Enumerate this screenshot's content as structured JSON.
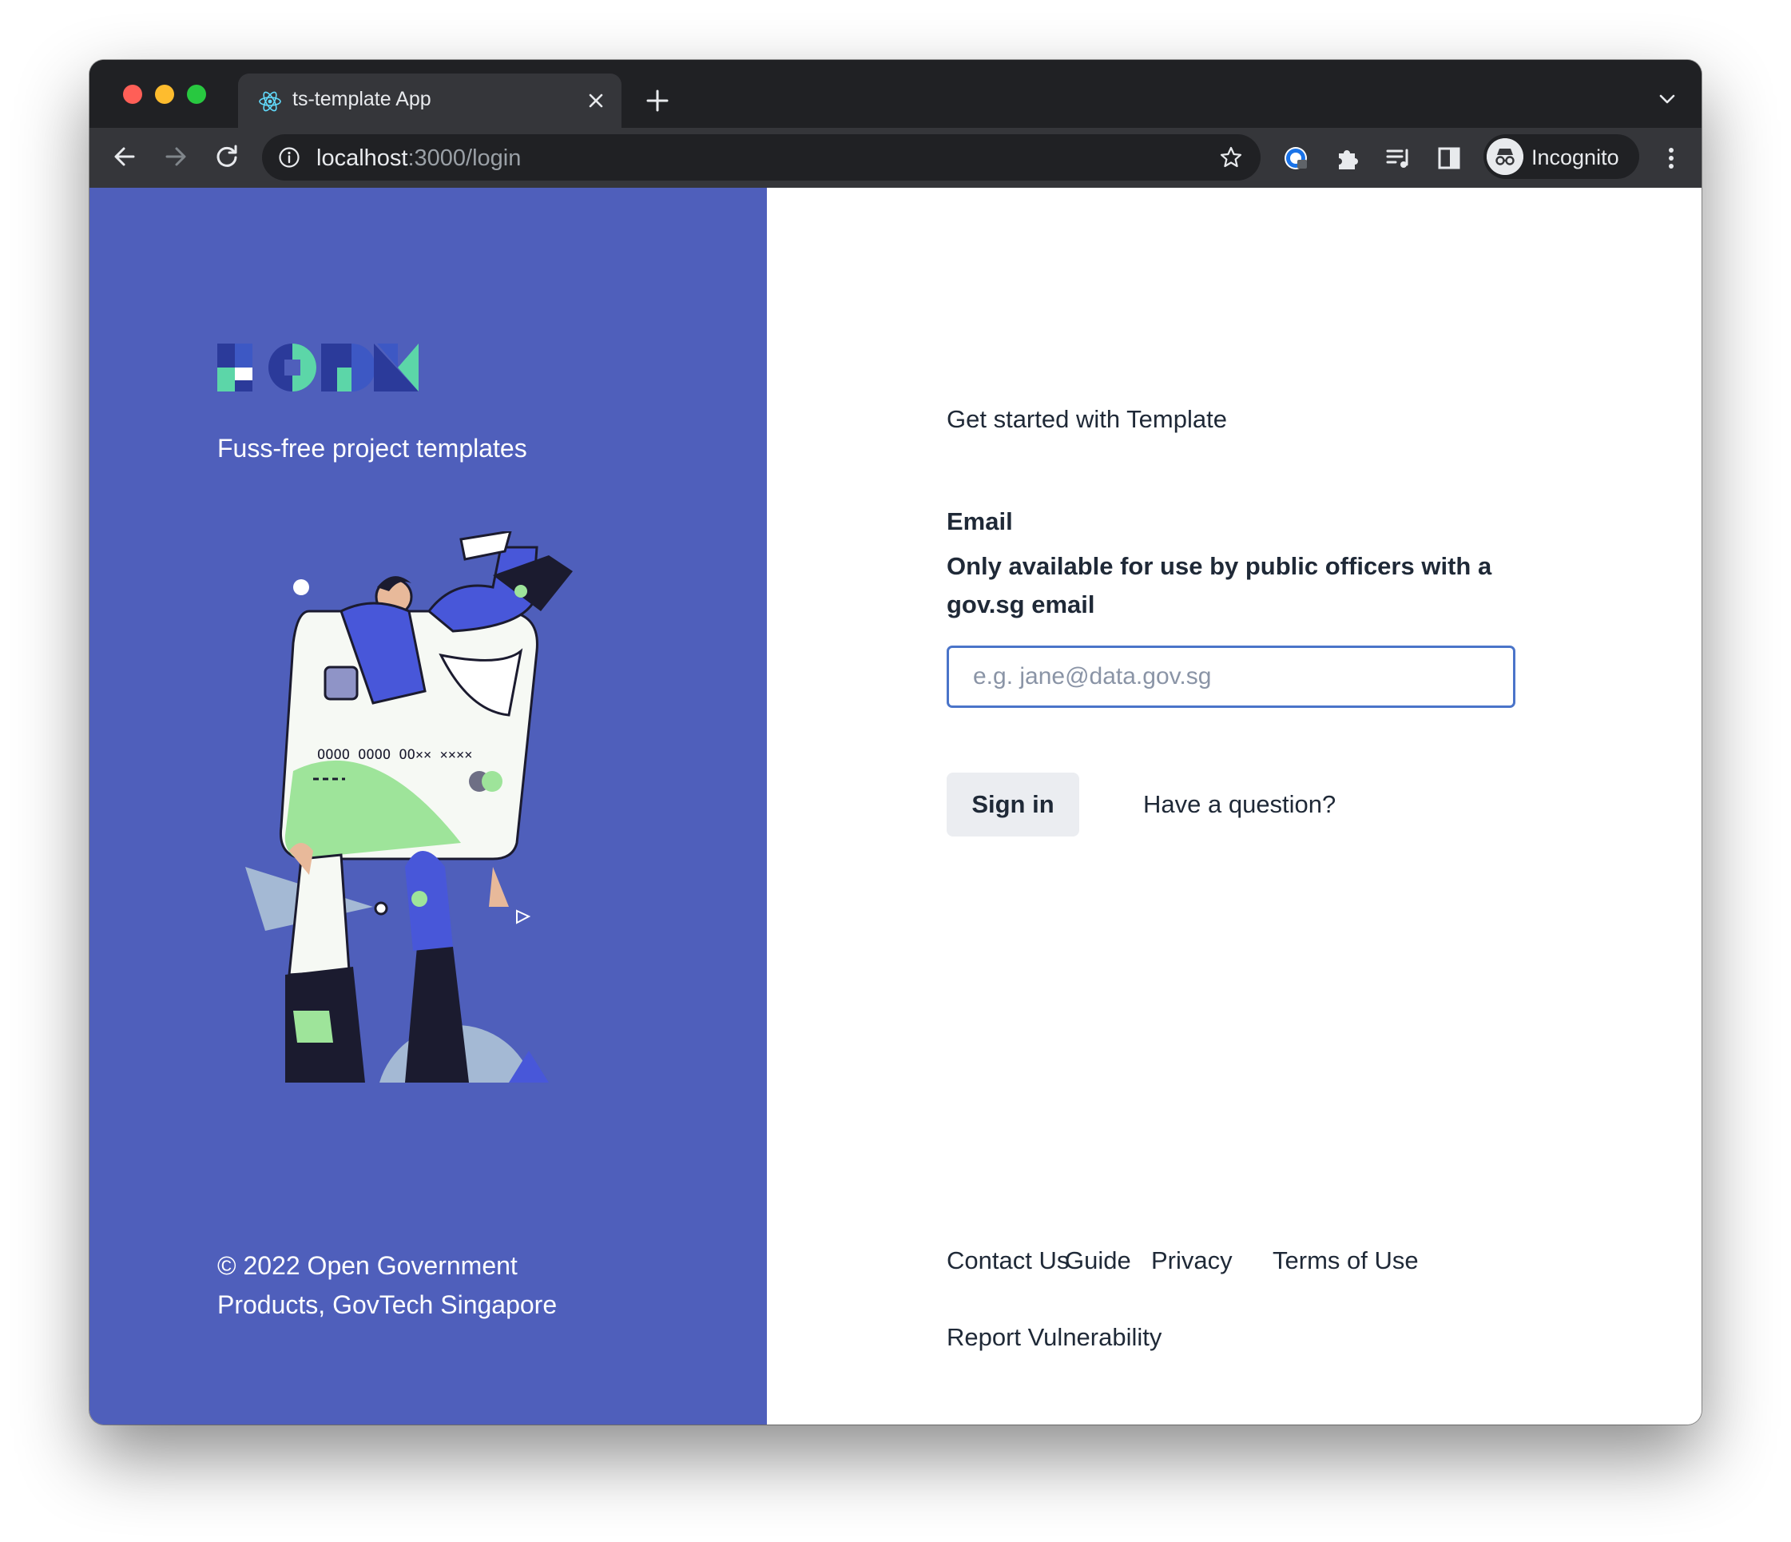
{
  "browser": {
    "tab_title": "ts-template App",
    "url_host": "localhost",
    "url_path": ":3000/login",
    "profile_label": "Incognito"
  },
  "left": {
    "tagline": "Fuss-free project templates",
    "copyright_line1": "© 2022 Open Government",
    "copyright_line2": "Products, GovTech Singapore"
  },
  "login": {
    "heading": "Get started with Template",
    "email_label": "Email",
    "email_description": "Only available for use by public officers with a gov.sg email",
    "email_placeholder": "e.g. jane@data.gov.sg",
    "email_value": "",
    "signin_label": "Sign in",
    "question_label": "Have a question?"
  },
  "footer": {
    "links": [
      "Contact Us",
      "Guide",
      "Privacy",
      "Terms of Use",
      "Report Vulnerability"
    ]
  },
  "colors": {
    "brand_blue": "#4f5fbb",
    "input_focus": "#4a74c9",
    "logo_green": "#5cd6a8",
    "illustration_green": "#9ee49a"
  }
}
